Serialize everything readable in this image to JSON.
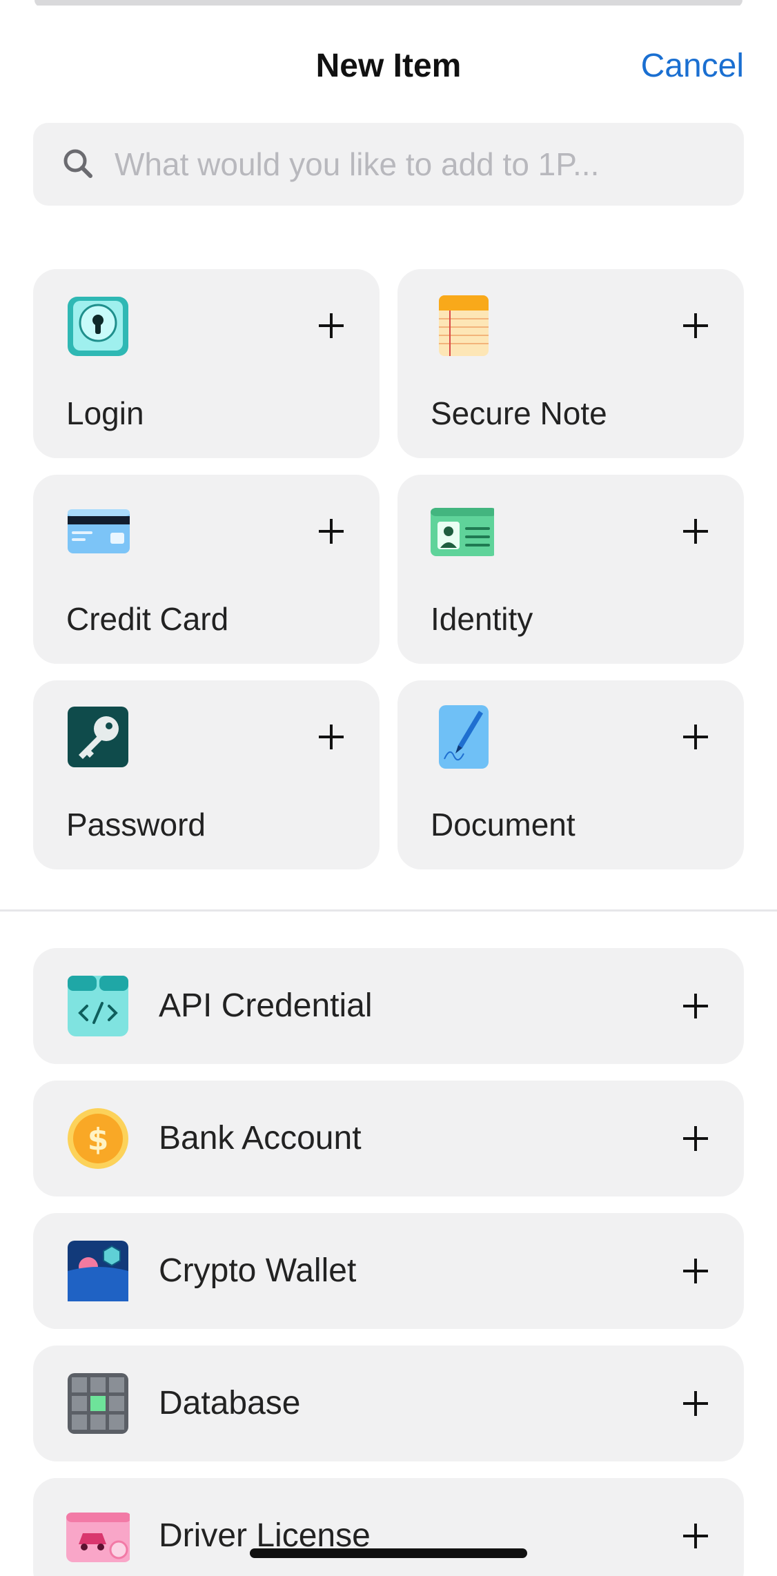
{
  "header": {
    "title": "New Item",
    "cancel_label": "Cancel"
  },
  "search": {
    "placeholder": "What would you like to add to 1P..."
  },
  "featured": [
    {
      "label": "Login",
      "icon": "login-keyhole-icon"
    },
    {
      "label": "Secure Note",
      "icon": "secure-note-icon"
    },
    {
      "label": "Credit Card",
      "icon": "credit-card-icon"
    },
    {
      "label": "Identity",
      "icon": "identity-card-icon"
    },
    {
      "label": "Password",
      "icon": "key-icon"
    },
    {
      "label": "Document",
      "icon": "document-pen-icon"
    }
  ],
  "categories": [
    {
      "label": "API Credential",
      "icon": "api-code-icon"
    },
    {
      "label": "Bank Account",
      "icon": "dollar-coin-icon"
    },
    {
      "label": "Crypto Wallet",
      "icon": "crypto-wallet-icon"
    },
    {
      "label": "Database",
      "icon": "database-grid-icon"
    },
    {
      "label": "Driver License",
      "icon": "car-license-icon"
    }
  ],
  "colors": {
    "accent": "#1a6fd1",
    "card_bg": "#f1f1f2"
  }
}
